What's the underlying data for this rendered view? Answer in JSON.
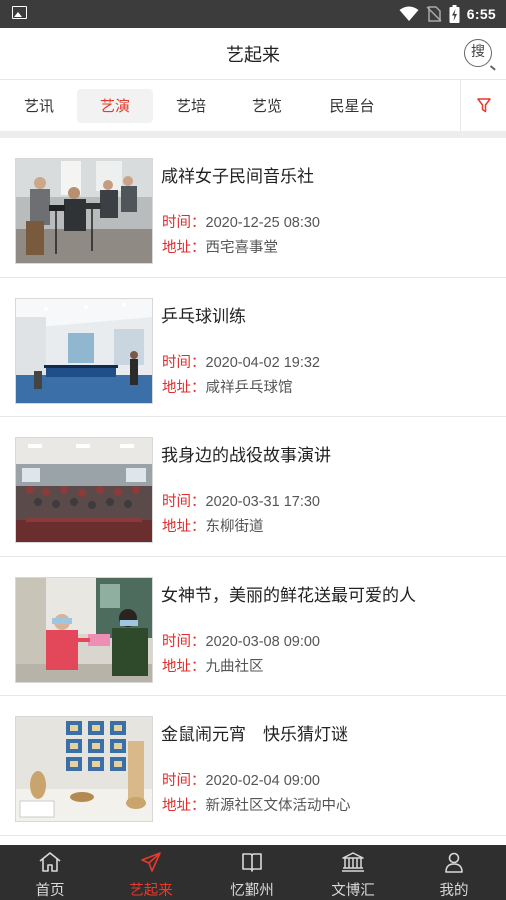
{
  "status_bar": {
    "time": "6:55"
  },
  "header": {
    "title": "艺起来",
    "search_label": "搜"
  },
  "tabs": [
    {
      "label": "艺讯",
      "active": false
    },
    {
      "label": "艺演",
      "active": true
    },
    {
      "label": "艺培",
      "active": false
    },
    {
      "label": "艺览",
      "active": false
    },
    {
      "label": "民星台",
      "active": false
    }
  ],
  "events": [
    {
      "title": "咸祥女子民间音乐社",
      "time_label": "时间：",
      "time": "2020-12-25 08:30",
      "address_label": "地址：",
      "address": "西宅喜事堂"
    },
    {
      "title": "乒乓球训练",
      "time_label": "时间：",
      "time": "2020-04-02 19:32",
      "address_label": "地址：",
      "address": "咸祥乒乓球馆"
    },
    {
      "title": "我身边的战役故事演讲",
      "time_label": "时间：",
      "time": "2020-03-31 17:30",
      "address_label": "地址：",
      "address": "东柳街道"
    },
    {
      "title": "女神节，美丽的鲜花送最可爱的人",
      "time_label": "时间：",
      "time": "2020-03-08 09:00",
      "address_label": "地址：",
      "address": "九曲社区"
    },
    {
      "title": "金鼠闹元宵　快乐猜灯谜",
      "time_label": "时间：",
      "time": "2020-02-04 09:00",
      "address_label": "地址：",
      "address": "新源社区文体活动中心"
    }
  ],
  "bottom_nav": [
    {
      "label": "首页",
      "icon": "home-icon",
      "active": false
    },
    {
      "label": "艺起来",
      "icon": "paper-plane-icon",
      "active": true
    },
    {
      "label": "忆鄞州",
      "icon": "book-icon",
      "active": false
    },
    {
      "label": "文博汇",
      "icon": "museum-icon",
      "active": false
    },
    {
      "label": "我的",
      "icon": "user-icon",
      "active": false
    }
  ],
  "colors": {
    "accent": "#e8392b",
    "label_red": "#e02c2c",
    "nav_bg": "#2f2f2f",
    "status_bar": "#3c3c3c"
  }
}
